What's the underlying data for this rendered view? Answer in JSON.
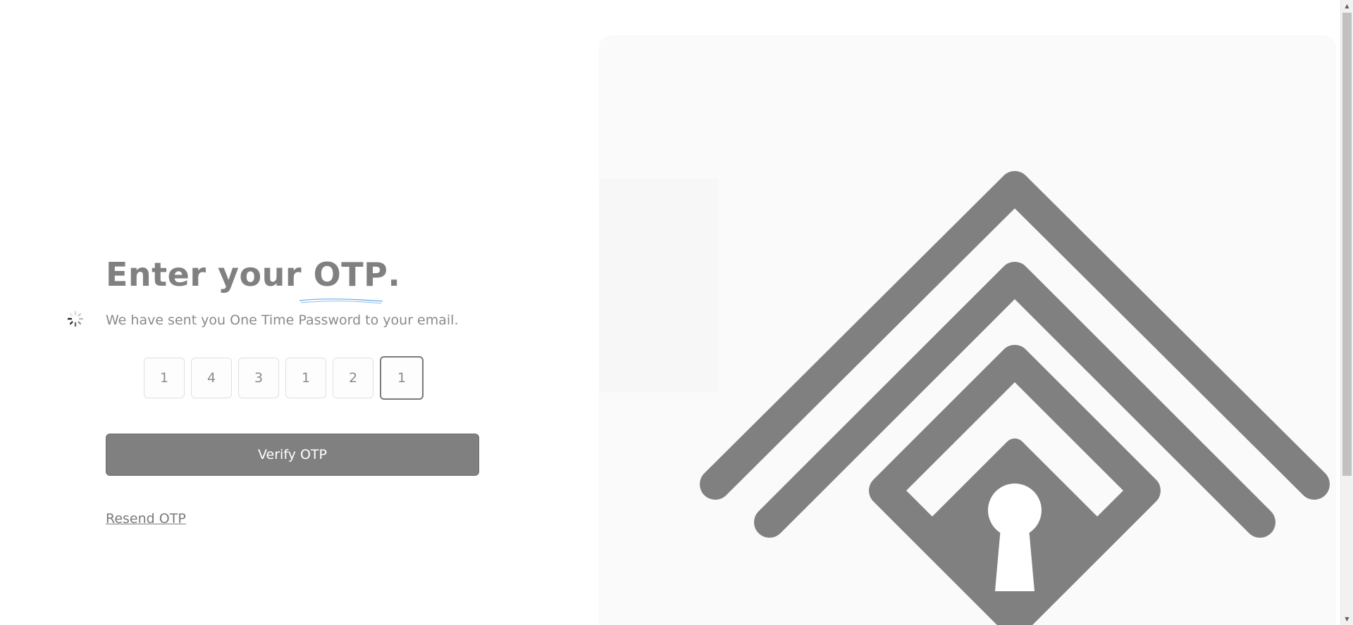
{
  "form": {
    "title_prefix": "Enter your ",
    "title_highlight": "OTP",
    "title_suffix": ".",
    "subtitle": "We have sent you One Time Password to your email.",
    "otp_digits": [
      "1",
      "4",
      "3",
      "1",
      "2",
      "1"
    ],
    "active_index": 5,
    "verify_label": "Verify OTP",
    "resend_label": "Resend OTP"
  },
  "illustration": {
    "icon": "keyhole-lock-icon",
    "loading_icon": "loading-spinner-icon"
  },
  "colors": {
    "primary_gray": "#808080",
    "underline_accent": "#6aa9e9",
    "text_muted": "#8a8a8a"
  }
}
